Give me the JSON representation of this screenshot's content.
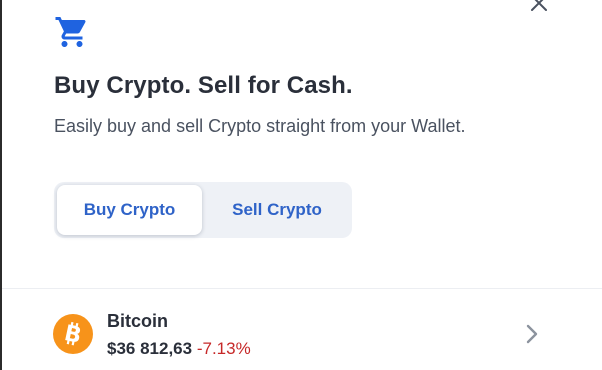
{
  "header": {
    "title": "Buy Crypto. Sell for Cash.",
    "subtitle": "Easily buy and sell Crypto straight from your Wallet."
  },
  "toggle": {
    "buy_label": "Buy Crypto",
    "sell_label": "Sell Crypto",
    "selected": "buy"
  },
  "assets": [
    {
      "name": "Bitcoin",
      "price": "$36 812,63",
      "change": "-7.13%",
      "icon": "bitcoin-icon",
      "color": "#f7931a"
    }
  ],
  "colors": {
    "accent": "#2f63c8",
    "cart": "#1f63e0",
    "negative": "#c62828"
  },
  "icons": {
    "cart": "shopping-cart-icon",
    "close": "close-icon",
    "chevron": "chevron-right-icon"
  }
}
